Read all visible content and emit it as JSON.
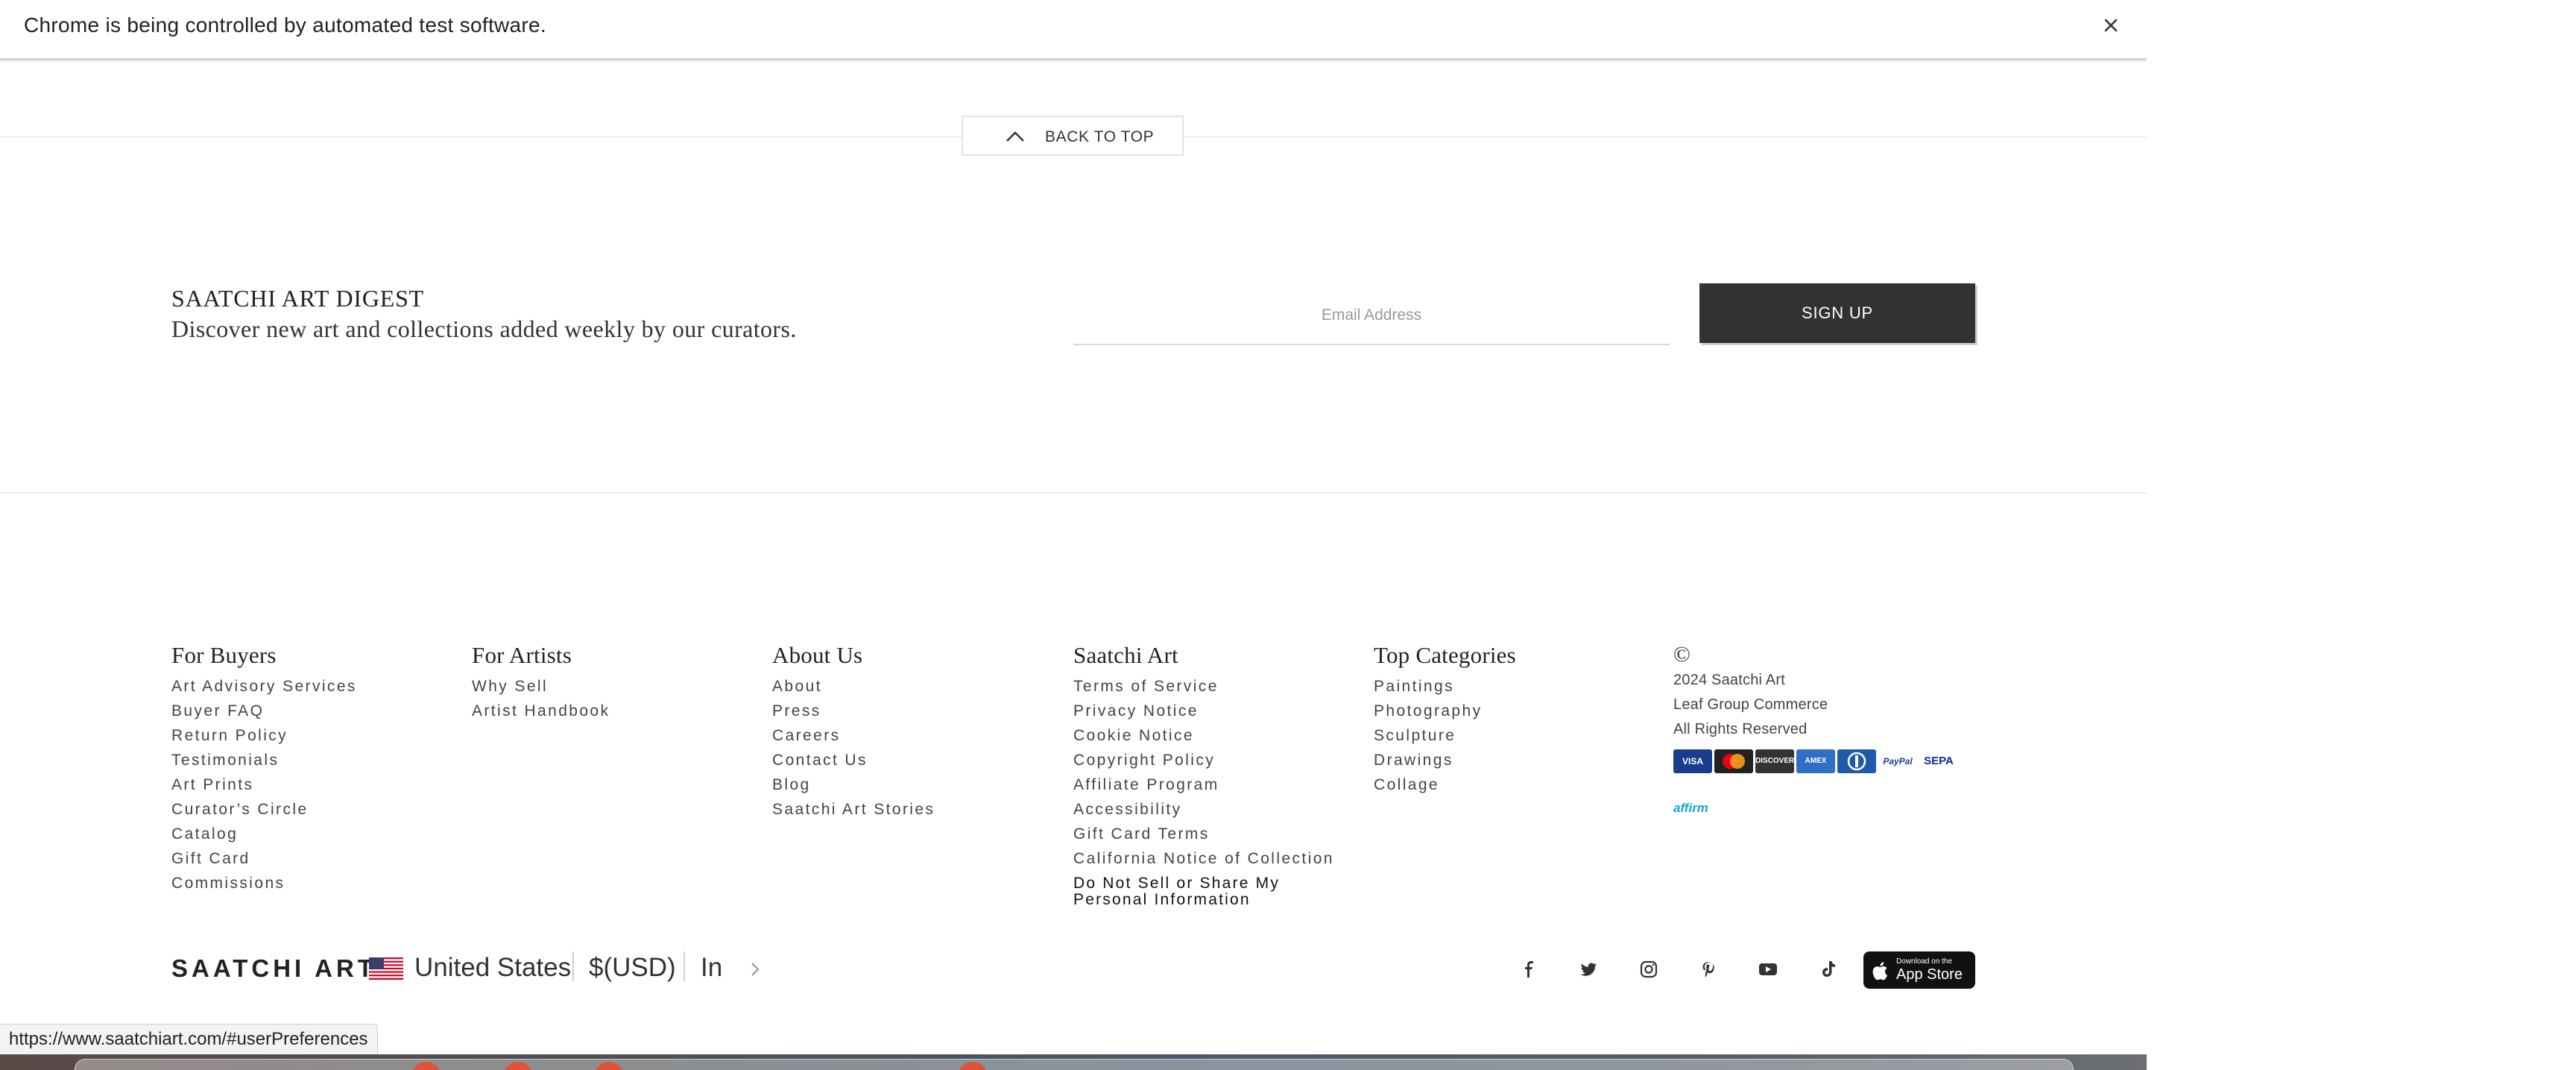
{
  "infobar": {
    "message": "Chrome is being controlled by automated test software.",
    "close_icon": "close-icon"
  },
  "back_to_top": {
    "label": "BACK TO TOP",
    "icon": "chevron-up-icon"
  },
  "digest": {
    "title": "SAATCHI ART DIGEST",
    "subtitle": "Discover new art and collections added weekly by our curators.",
    "email_placeholder": "Email Address",
    "signup_label": "SIGN UP"
  },
  "footer": {
    "columns": [
      {
        "heading": "For Buyers",
        "links": [
          "Art Advisory Services",
          "Buyer FAQ",
          "Return Policy",
          "Testimonials",
          "Art Prints",
          "Curator’s Circle",
          "Catalog",
          "Gift Card",
          "Commissions"
        ]
      },
      {
        "heading": "For Artists",
        "links": [
          "Why Sell",
          "Artist Handbook"
        ]
      },
      {
        "heading": "About Us",
        "links": [
          "About",
          "Press",
          "Careers",
          "Contact Us",
          "Blog",
          "Saatchi Art Stories"
        ]
      },
      {
        "heading": "Saatchi Art",
        "links": [
          "Terms of Service",
          "Privacy Notice",
          "Cookie Notice",
          "Copyright Policy",
          "Affiliate Program",
          "Accessibility",
          "Gift Card Terms",
          "California Notice of Collection"
        ],
        "strong_link": "Do Not Sell or Share My Personal Information"
      },
      {
        "heading": "Top Categories",
        "links": [
          "Paintings",
          "Photography",
          "Sculpture",
          "Drawings",
          "Collage"
        ]
      }
    ],
    "legal": {
      "copyright_symbol": "©",
      "lines": [
        "2024 Saatchi Art",
        "Leaf Group Commerce",
        "All Rights Reserved"
      ]
    },
    "payment_cards": [
      {
        "label": "VISA",
        "color": "#1a3c8f"
      },
      {
        "label": "MC",
        "color": "#222222"
      },
      {
        "label": "DISCOVER",
        "color": "#333333"
      },
      {
        "label": "AMEX",
        "color": "#2f6fc4"
      },
      {
        "label": "DC",
        "color": "#1f5aa8"
      },
      {
        "label": "PayPal",
        "color": "#ffffff"
      },
      {
        "label": "SEPA",
        "color": "#ffffff"
      }
    ],
    "affirm": "affirm"
  },
  "bottom_bar": {
    "brand": "SAATCHI ART",
    "country": "United States",
    "currency": "$(USD)",
    "unit": "In",
    "social_icons": [
      "facebook-icon",
      "twitter-icon",
      "instagram-icon",
      "pinterest-icon",
      "youtube-icon",
      "tiktok-icon"
    ],
    "appstore_small": "Download on the",
    "appstore_big": "App Store"
  },
  "status_url": "https://www.saatchiart.com/#userPreferences"
}
